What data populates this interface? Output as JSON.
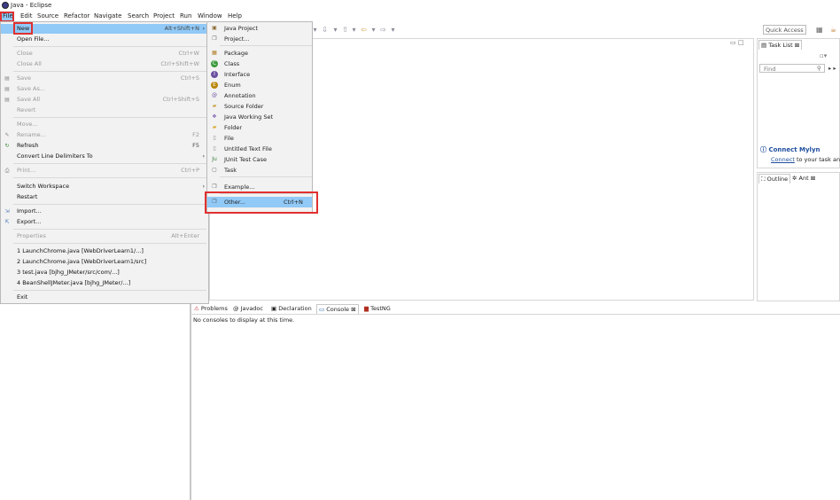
{
  "window": {
    "title": "Java - Eclipse"
  },
  "menubar": [
    "File",
    "Edit",
    "Source",
    "Refactor",
    "Navigate",
    "Search",
    "Project",
    "Run",
    "Window",
    "Help"
  ],
  "toolbar": {
    "quick_access_placeholder": "Quick Access"
  },
  "file_menu": {
    "new": {
      "label": "New",
      "shortcut": "Alt+Shift+N"
    },
    "open_file": {
      "label": "Open File..."
    },
    "close": {
      "label": "Close",
      "shortcut": "Ctrl+W"
    },
    "close_all": {
      "label": "Close All",
      "shortcut": "Ctrl+Shift+W"
    },
    "save": {
      "label": "Save",
      "shortcut": "Ctrl+S"
    },
    "save_as": {
      "label": "Save As..."
    },
    "save_all": {
      "label": "Save All",
      "shortcut": "Ctrl+Shift+S"
    },
    "revert": {
      "label": "Revert"
    },
    "move": {
      "label": "Move..."
    },
    "rename": {
      "label": "Rename...",
      "shortcut": "F2"
    },
    "refresh": {
      "label": "Refresh",
      "shortcut": "F5"
    },
    "convert": {
      "label": "Convert Line Delimiters To"
    },
    "print": {
      "label": "Print...",
      "shortcut": "Ctrl+P"
    },
    "switch_workspace": {
      "label": "Switch Workspace"
    },
    "restart": {
      "label": "Restart"
    },
    "import": {
      "label": "Import..."
    },
    "export": {
      "label": "Export..."
    },
    "properties": {
      "label": "Properties",
      "shortcut": "Alt+Enter"
    },
    "recent": [
      "1 LaunchChrome.java  [WebDriverLearn1/...]",
      "2 LaunchChrome.java  [WebDriverLearn1/src]",
      "3 test.java  [bjhg_JMeter/src/com/...]",
      "4 BeanShellJMeter.java  [bjhg_JMeter/...]"
    ],
    "exit": {
      "label": "Exit"
    }
  },
  "new_submenu": {
    "items": [
      "Java Project",
      "Project...",
      "Package",
      "Class",
      "Interface",
      "Enum",
      "Annotation",
      "Source Folder",
      "Java Working Set",
      "Folder",
      "File",
      "Untitled Text File",
      "JUnit Test Case",
      "Task",
      "Example...",
      "Other..."
    ],
    "other_shortcut": "Ctrl+N"
  },
  "task_list": {
    "tab": "Task List",
    "find_placeholder": "Find",
    "mylyn_title": "Connect Mylyn",
    "mylyn_link": "Connect",
    "mylyn_text": " to your task and"
  },
  "outline_tabs": [
    "Outline",
    "Ant"
  ],
  "console_tabs": [
    "Problems",
    "Javadoc",
    "Declaration",
    "Console",
    "TestNG"
  ],
  "console_message": "No consoles to display at this time.",
  "colors": {
    "highlight": "#91c9f7",
    "annotation_red": "#e03030",
    "mylyn_blue": "#1f4e9e"
  }
}
